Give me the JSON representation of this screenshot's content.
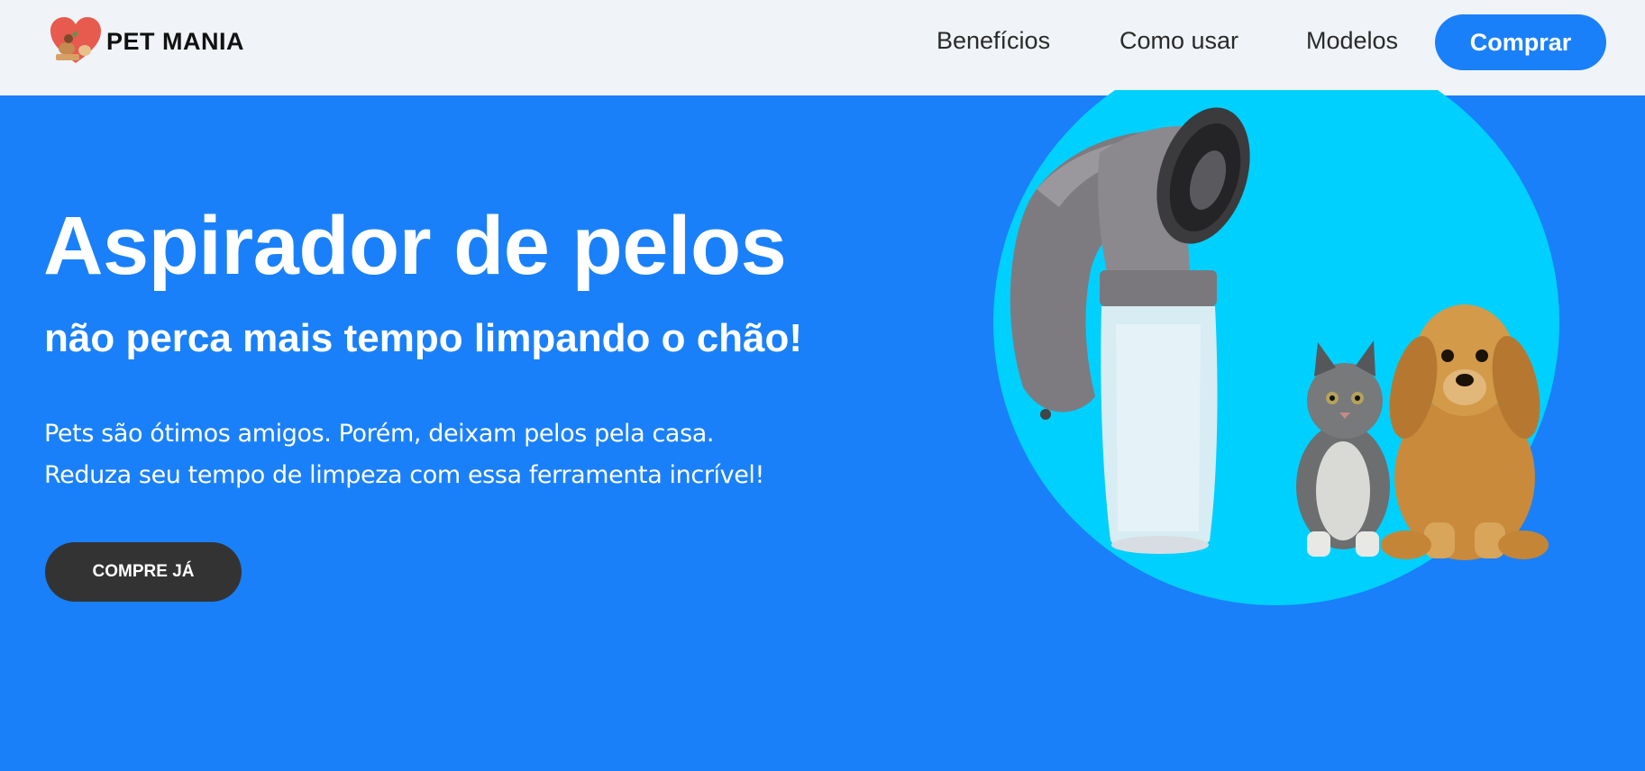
{
  "header": {
    "brand": "PET MANIA",
    "nav": [
      "Benefícios",
      "Como usar",
      "Modelos"
    ],
    "cta": "Comprar"
  },
  "hero": {
    "title": "Aspirador de pelos",
    "subtitle": "não perca mais tempo limpando o chão!",
    "description_line1": "Pets são ótimos amigos. Porém, deixam pelos pela casa.",
    "description_line2": "Reduza seu tempo de limpeza com essa ferramenta incrível!",
    "cta": "COMPRE JÁ"
  },
  "colors": {
    "primary": "#1a80f9",
    "circle": "#00d0fe",
    "dark_button": "#333333",
    "header_bg": "#f0f3f7"
  }
}
